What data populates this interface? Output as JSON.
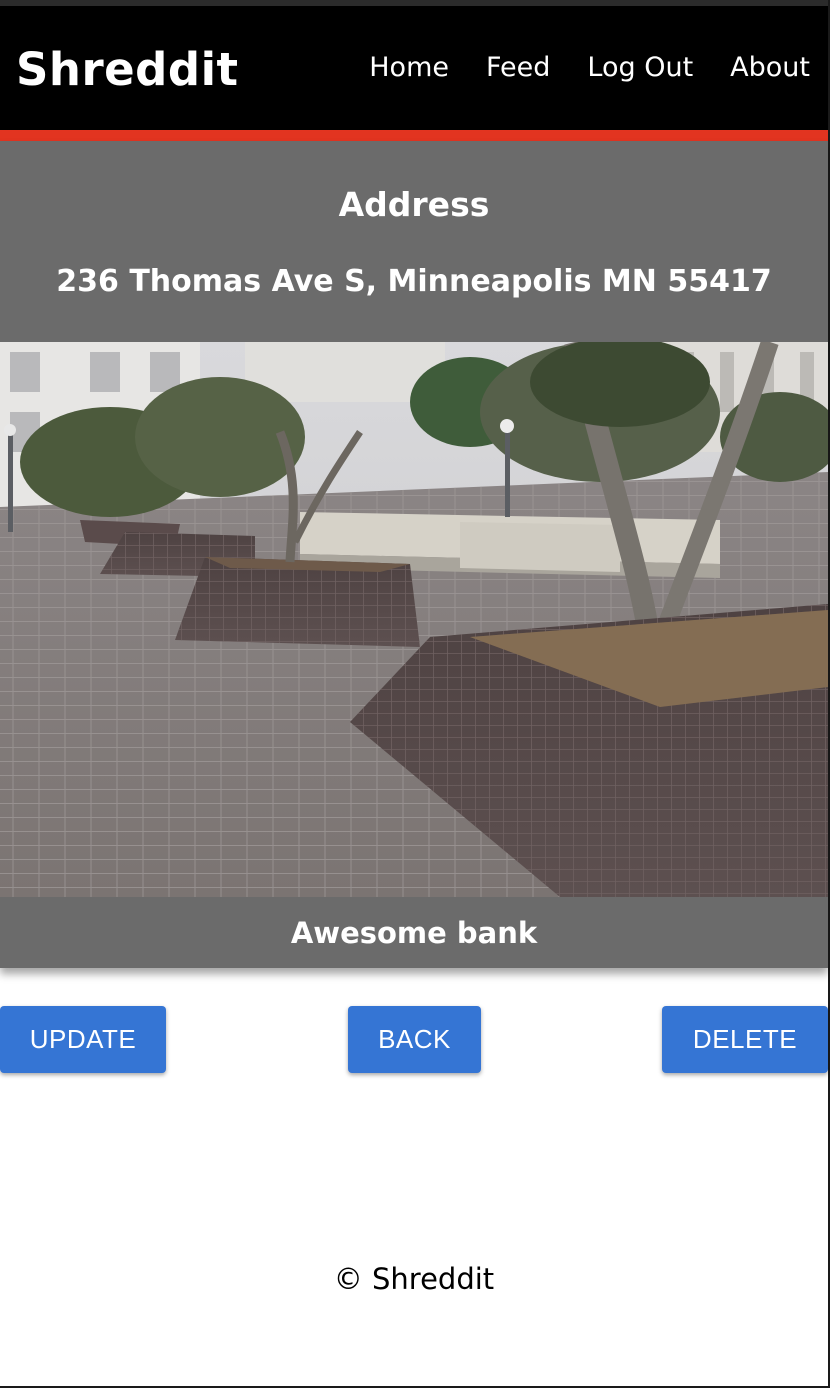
{
  "app": {
    "brand": "Shreddit"
  },
  "nav": {
    "items": [
      {
        "label": "Home"
      },
      {
        "label": "Feed"
      },
      {
        "label": "Log Out"
      },
      {
        "label": "About"
      }
    ]
  },
  "spot": {
    "heading": "Address",
    "address": "236 Thomas Ave S, Minneapolis MN 55417",
    "description": "Awesome bank"
  },
  "actions": {
    "update_label": "UPDATE",
    "back_label": "BACK",
    "delete_label": "DELETE"
  },
  "footer": {
    "text": "© Shreddit"
  },
  "colors": {
    "navbar": "#000000",
    "accent": "#e23420",
    "card": "#6b6b6b",
    "button": "#3575d4"
  }
}
